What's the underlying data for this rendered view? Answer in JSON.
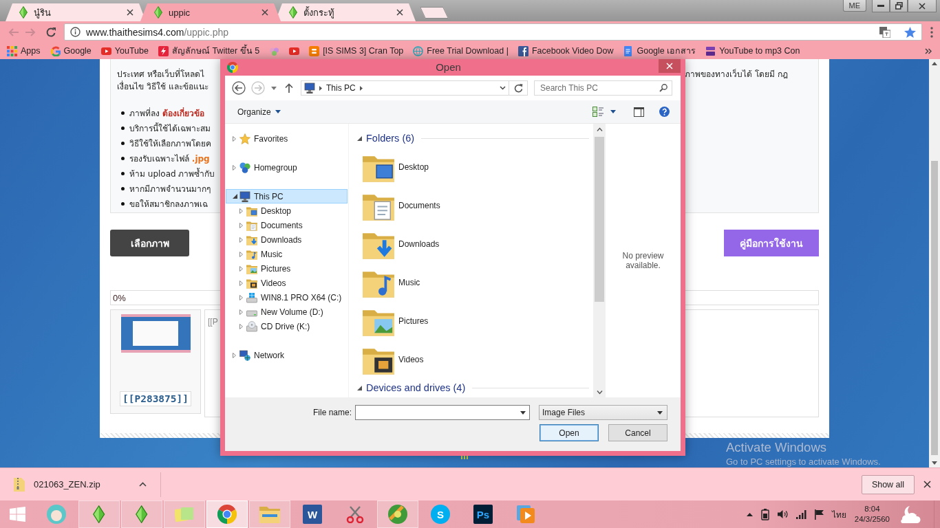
{
  "browser": {
    "tabs": [
      {
        "title": "นู๋ริน",
        "selected": false
      },
      {
        "title": "uppic",
        "selected": true
      },
      {
        "title": "ตั้งกระทู้",
        "selected": false
      }
    ],
    "profile": "ME",
    "address": {
      "host": "www.thaithesims4.com",
      "path": "/uppic.php"
    },
    "bookmarks": [
      {
        "kind": "apps",
        "label": "Apps"
      },
      {
        "kind": "google",
        "label": "Google"
      },
      {
        "kind": "youtube",
        "label": "YouTube"
      },
      {
        "kind": "flash",
        "label": "สัญลักษณ์ Twitter ขึ้น 5"
      },
      {
        "kind": "flower"
      },
      {
        "kind": "youtube"
      },
      {
        "kind": "blogger",
        "label": "[IS SIMS 3] Cran Top"
      },
      {
        "kind": "globe",
        "label": "Free Trial Download |"
      },
      {
        "kind": "facebook",
        "label": "Facebook Video Dow"
      },
      {
        "kind": "docs",
        "label": "Google เอกสาร"
      },
      {
        "kind": "mp3",
        "label": "YouTube to mp3 Con"
      }
    ]
  },
  "page": {
    "intro_left": [
      "ประเทศ หรือเว็บที่โหลดไ",
      "เงื่อนไข วิธีใช้ และข้อแนะ"
    ],
    "intro_right": [
      "ภาพของทางเว็บได้ โดยมี กฎ"
    ],
    "rules": [
      {
        "text": "ภาพที่ลง **ต้องเกี่ยวข้อ**",
        "color": "#c0281e"
      },
      {
        "text": "บริการนี้ใช้ได้เฉพาะสม"
      },
      {
        "text": "วิธีใช้ให้เลือกภาพโดยค"
      },
      {
        "text": "รองรับเฉพาะไฟล์ **.jpg**",
        "color": "#e8711a"
      },
      {
        "text": "ห้าม upload ภาพซ้ำกับ"
      },
      {
        "text": "หากมีภาพจำนวนมากๆ"
      },
      {
        "text": "ขอให้สมาชิกลงภาพเฉ"
      }
    ],
    "choose_button": "เลือกภาพ",
    "manual_button": "คู่มือการใช้งาน",
    "progress": {
      "label": "0%"
    },
    "uploads": [
      {
        "code": "[[P283875]]"
      }
    ],
    "code_preview": "[[P"
  },
  "dialog": {
    "title": "Open",
    "breadcrumb": [
      "This PC"
    ],
    "search_placeholder": "Search This PC",
    "organize": "Organize",
    "tree": [
      {
        "label": "Favorites",
        "kind": "favorites",
        "expanded": false,
        "selected": false
      },
      {
        "label": "Homegroup",
        "kind": "homegroup",
        "expanded": false,
        "selected": false
      },
      {
        "label": "This PC",
        "kind": "pc",
        "expanded": true,
        "selected": true,
        "children": [
          {
            "label": "Desktop",
            "kind": "desktop",
            "expanded": false,
            "selected": false
          },
          {
            "label": "Documents",
            "kind": "documents",
            "expanded": false,
            "selected": false
          },
          {
            "label": "Downloads",
            "kind": "downloads",
            "expanded": false,
            "selected": false
          },
          {
            "label": "Music",
            "kind": "music",
            "expanded": false,
            "selected": false
          },
          {
            "label": "Pictures",
            "kind": "pictures",
            "expanded": false,
            "selected": false
          },
          {
            "label": "Videos",
            "kind": "videos",
            "expanded": false,
            "selected": false
          },
          {
            "label": "WIN8.1 PRO X64 (C:)",
            "kind": "system-drive",
            "expanded": false,
            "selected": false
          },
          {
            "label": "New Volume (D:)",
            "kind": "drive",
            "expanded": false,
            "selected": false
          },
          {
            "label": "CD Drive (K:)",
            "kind": "cd-drive",
            "expanded": false,
            "selected": false
          }
        ]
      },
      {
        "label": "Network",
        "kind": "network",
        "expanded": false,
        "selected": false
      }
    ],
    "groups": [
      {
        "title": "Folders (6)",
        "expanded": true,
        "items": [
          {
            "name": "Desktop",
            "kind": "desktop"
          },
          {
            "name": "Documents",
            "kind": "documents"
          },
          {
            "name": "Downloads",
            "kind": "downloads"
          },
          {
            "name": "Music",
            "kind": "music"
          },
          {
            "name": "Pictures",
            "kind": "pictures"
          },
          {
            "name": "Videos",
            "kind": "videos"
          }
        ]
      },
      {
        "title": "Devices and drives (4)",
        "expanded": true
      }
    ],
    "preview": "No preview available.",
    "file_name_label": "File name:",
    "file_type": "Image Files",
    "buttons": [
      {
        "label": "Open",
        "default": true
      },
      {
        "label": "Cancel",
        "default": false
      }
    ]
  },
  "downloads": {
    "file": "021063_ZEN.zip",
    "show_all": "Show all"
  },
  "taskbar": {
    "apps": [
      {
        "kind": "avatar",
        "running": false,
        "selected": false
      },
      {
        "kind": "sims",
        "running": true,
        "selected": false
      },
      {
        "kind": "sims",
        "running": true,
        "selected": false
      },
      {
        "kind": "notes",
        "running": true,
        "selected": false
      },
      {
        "kind": "chrome",
        "running": true,
        "selected": true
      },
      {
        "kind": "explorer",
        "running": true,
        "selected": false
      },
      {
        "kind": "word",
        "glyph": "W",
        "running": false,
        "selected": false
      },
      {
        "kind": "scissors",
        "running": false,
        "selected": false
      },
      {
        "kind": "game",
        "running": true,
        "selected": false
      },
      {
        "kind": "skype",
        "glyph": "S",
        "running": false,
        "selected": false
      },
      {
        "kind": "photoshop",
        "glyph": "Ps",
        "running": false,
        "selected": false
      },
      {
        "kind": "player",
        "running": false,
        "selected": false
      }
    ],
    "language": "ไทย",
    "time": "8:04",
    "date": "24/3/2560"
  },
  "activation": {
    "title": "Activate Windows",
    "detail": "Go to PC settings to activate Windows."
  }
}
